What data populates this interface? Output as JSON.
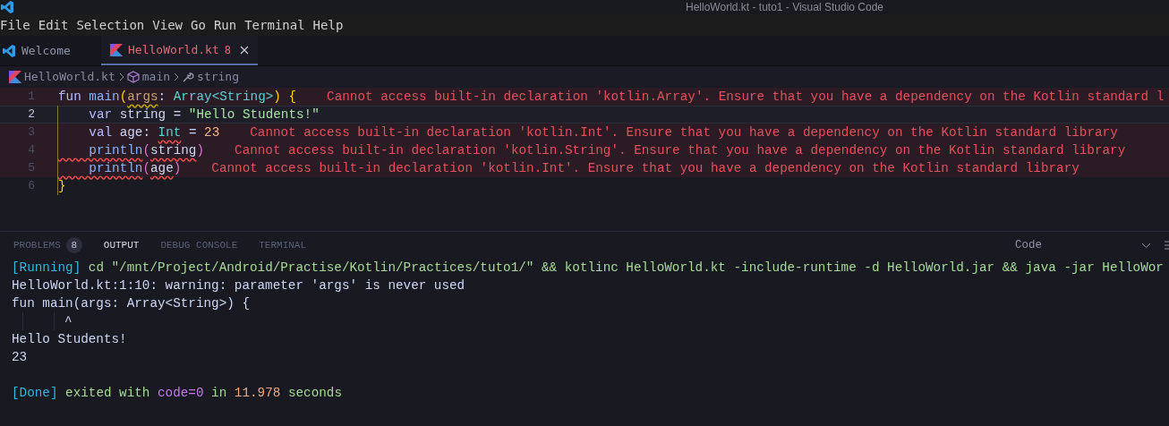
{
  "window": {
    "title": "HelloWorld.kt - tuto1 - Visual Studio Code"
  },
  "menu": [
    "File",
    "Edit",
    "Selection",
    "View",
    "Go",
    "Run",
    "Terminal",
    "Help"
  ],
  "tabs": [
    {
      "label": "Welcome",
      "kind": "welcome",
      "selected": false
    },
    {
      "label": "HelloWorld.kt",
      "kind": "kotlin",
      "count": "8",
      "selected": true
    }
  ],
  "breadcrumbs": [
    {
      "label": "HelloWorld.kt",
      "kind": "file"
    },
    {
      "label": "main",
      "kind": "function"
    },
    {
      "label": "string",
      "kind": "variable"
    }
  ],
  "editor": {
    "lines": [
      {
        "number": "1",
        "current": false,
        "tokens": [
          {
            "text": "fun ",
            "kind": "kw"
          },
          {
            "text": "main",
            "kind": "fn"
          },
          {
            "text": "(",
            "kind": "bracket1"
          },
          {
            "text": "args",
            "kind": "param",
            "warning": true
          },
          {
            "text": ": ",
            "kind": "plain"
          },
          {
            "text": "Array",
            "kind": "type"
          },
          {
            "text": "<",
            "kind": "type"
          },
          {
            "text": "String",
            "kind": "type"
          },
          {
            "text": ">",
            "kind": "type"
          },
          {
            "text": ")",
            "kind": "bracket1"
          },
          {
            "text": " {",
            "kind": "bracket1"
          }
        ],
        "error": "Cannot access built-in declaration 'kotlin.Array'. Ensure that you have a dependency on the Kotlin standard l"
      },
      {
        "number": "2",
        "current": true,
        "tokens": [
          {
            "text": "    var",
            "kind": "kw"
          },
          {
            "text": " string = ",
            "kind": "plain"
          },
          {
            "text": "\"Hello Students!\"",
            "kind": "str"
          }
        ]
      },
      {
        "number": "3",
        "current": false,
        "tokens": [
          {
            "text": "    val",
            "kind": "kw"
          },
          {
            "text": " age: ",
            "kind": "plain"
          },
          {
            "text": "Int",
            "kind": "type",
            "error": true
          },
          {
            "text": " = ",
            "kind": "plain"
          },
          {
            "text": "23",
            "kind": "num"
          }
        ],
        "error": "Cannot access built-in declaration 'kotlin.Int'. Ensure that you have a dependency on the Kotlin standard library"
      },
      {
        "number": "4",
        "current": false,
        "tokens": [
          {
            "text": "    println",
            "kind": "fn",
            "error": true
          },
          {
            "text": "(",
            "kind": "bracket2"
          },
          {
            "text": "string",
            "kind": "plain",
            "error": true
          },
          {
            "text": ")",
            "kind": "bracket2"
          }
        ],
        "error": "Cannot access built-in declaration 'kotlin.String'. Ensure that you have a dependency on the Kotlin standard library"
      },
      {
        "number": "5",
        "current": false,
        "tokens": [
          {
            "text": "    println",
            "kind": "fn",
            "error": true
          },
          {
            "text": "(",
            "kind": "bracket2"
          },
          {
            "text": "age",
            "kind": "plain",
            "error": true
          },
          {
            "text": ")",
            "kind": "bracket2"
          }
        ],
        "error": "Cannot access built-in declaration 'kotlin.Int'. Ensure that you have a dependency on the Kotlin standard library"
      },
      {
        "number": "6",
        "current": false,
        "tokens": [
          {
            "text": "}",
            "kind": "bracket1"
          }
        ]
      }
    ]
  },
  "panel": {
    "tabs": [
      {
        "label": "PROBLEMS",
        "count": "8",
        "selected": false
      },
      {
        "label": "OUTPUT",
        "selected": true
      },
      {
        "label": "DEBUG CONSOLE",
        "selected": false
      },
      {
        "label": "TERMINAL",
        "selected": false
      }
    ],
    "channel": "Code",
    "output": [
      {
        "kind": "text",
        "tokens": [
          {
            "text": "[Running]",
            "kind": "tag"
          },
          {
            "text": " cd \"/mnt/Project/Android/Practise/Kotlin/Practices/tuto1/\" && kotlinc HelloWorld.kt -include-runtime -d HelloWorld.jar && java -jar HelloWor",
            "kind": "green"
          }
        ]
      },
      {
        "kind": "text",
        "tokens": [
          {
            "text": "HelloWorld.kt:1:10: warning: parameter 'args' is never used",
            "kind": "plain"
          }
        ]
      },
      {
        "kind": "text",
        "tokens": [
          {
            "text": "fun main(args: Array<String>) {",
            "kind": "plain"
          }
        ]
      },
      {
        "kind": "caret",
        "tokens": [
          {
            "text": "^",
            "kind": "plain"
          }
        ]
      },
      {
        "kind": "text",
        "tokens": [
          {
            "text": "Hello Students!",
            "kind": "plain"
          }
        ]
      },
      {
        "kind": "text",
        "tokens": [
          {
            "text": "23",
            "kind": "plain"
          }
        ]
      },
      {
        "kind": "blank"
      },
      {
        "kind": "text",
        "tokens": [
          {
            "text": "[Done]",
            "kind": "tag"
          },
          {
            "text": " exited with ",
            "kind": "green"
          },
          {
            "text": "code=0",
            "kind": "purple"
          },
          {
            "text": " in ",
            "kind": "green"
          },
          {
            "text": "11.978",
            "kind": "orange"
          },
          {
            "text": " seconds",
            "kind": "green"
          }
        ]
      }
    ]
  }
}
